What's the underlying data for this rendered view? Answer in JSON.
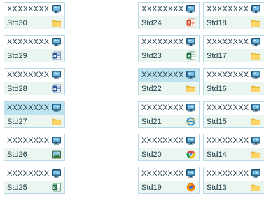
{
  "columns": {
    "left": [
      {
        "code": "XXXXXXXX",
        "name": "Std30",
        "file_icon": "folder-icon",
        "highlight": false
      },
      {
        "code": "XXXXXXXX",
        "name": "Std29",
        "file_icon": "word-icon",
        "highlight": false
      },
      {
        "code": "XXXXXXXX",
        "name": "Std28",
        "file_icon": "word-icon",
        "highlight": false
      },
      {
        "code": "XXXXXXXX",
        "name": "Std27",
        "file_icon": "folder-icon",
        "highlight": true
      },
      {
        "code": "XXXXXXXX",
        "name": "Std26",
        "file_icon": "picture-icon",
        "highlight": false
      },
      {
        "code": "XXXXXXXX",
        "name": "Std25",
        "file_icon": "excel-icon",
        "highlight": false
      }
    ],
    "middle": [
      {
        "code": "XXXXXXXX",
        "name": "Std24",
        "file_icon": "powerpoint-icon",
        "highlight": false
      },
      {
        "code": "XXXXXXXX",
        "name": "Std23",
        "file_icon": "excel-icon",
        "highlight": false
      },
      {
        "code": "XXXXXXXX",
        "name": "Std22",
        "file_icon": "folder-icon",
        "highlight": true
      },
      {
        "code": "XXXXXXXX",
        "name": "Std21",
        "file_icon": "ie-icon",
        "highlight": false
      },
      {
        "code": "XXXXXXXX",
        "name": "Std20",
        "file_icon": "chrome-icon",
        "highlight": false
      },
      {
        "code": "XXXXXXXX",
        "name": "Std19",
        "file_icon": "firefox-icon",
        "highlight": false
      }
    ],
    "right": [
      {
        "code": "XXXXXXXX",
        "name": "Std18",
        "file_icon": "folder-icon",
        "highlight": false
      },
      {
        "code": "XXXXXXXX",
        "name": "Std17",
        "file_icon": "folder-icon",
        "highlight": false
      },
      {
        "code": "XXXXXXXX",
        "name": "Std16",
        "file_icon": "folder-icon",
        "highlight": false
      },
      {
        "code": "XXXXXXXX",
        "name": "Std15",
        "file_icon": "folder-icon",
        "highlight": false
      },
      {
        "code": "XXXXXXXX",
        "name": "Std14",
        "file_icon": "folder-icon",
        "highlight": false
      },
      {
        "code": "XXXXXXXX",
        "name": "Std13",
        "file_icon": "folder-icon",
        "highlight": false
      }
    ]
  },
  "status_icon": "monitor-icon",
  "colors": {
    "border": "#b9d9e7",
    "highlight": "#bde4ee",
    "name_row": "#eaf6ef",
    "text": "#1d3b49"
  }
}
